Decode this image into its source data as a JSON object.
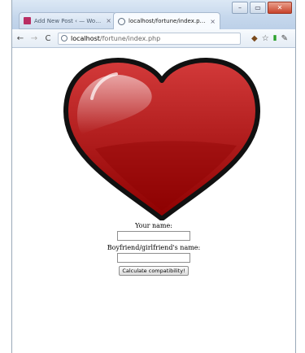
{
  "browser": {
    "tabs": [
      {
        "label": "Add New Post ‹ — WordPr",
        "active": false
      },
      {
        "label": "localhost/fortune/index.php",
        "active": true
      }
    ],
    "tab_close_glyph": "×",
    "window_controls": {
      "minimize": "–",
      "maximize": "▭",
      "close": "✕"
    },
    "address": {
      "host": "localhost",
      "path": "/fortune/index.php"
    },
    "toolbar_icons": [
      "back-icon",
      "forward-icon",
      "reload-icon",
      "extension-icon",
      "star-icon",
      "signal-icon",
      "wrench-icon"
    ]
  },
  "page": {
    "heart_colors": {
      "fill_top": "#d33a3a",
      "fill_bottom": "#8e0000",
      "outline": "#111111"
    },
    "form": {
      "your_name_label": "Your name:",
      "partner_name_label": "Boyfriend/girlfriend's name:",
      "your_name_value": "",
      "partner_name_value": "",
      "submit_label": "Calculate compatibility!"
    }
  }
}
